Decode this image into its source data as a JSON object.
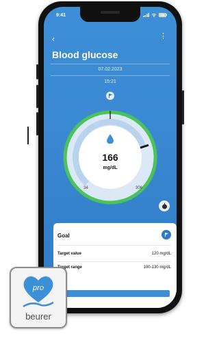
{
  "status_bar": {
    "time": "9:41"
  },
  "header": {
    "title": "Blood glucose"
  },
  "reading": {
    "date": "07.02.2023",
    "time": "15:21",
    "value": "166",
    "unit": "mg/dL",
    "scale_min": "34",
    "scale_max": "306"
  },
  "goal_card": {
    "title": "Goal",
    "rows": [
      {
        "label": "Target value",
        "value": "120 mg/dL"
      },
      {
        "label": "Target range",
        "value": "100-130 mg/dL"
      }
    ]
  },
  "logo": {
    "brand": "beurer",
    "badge": "pro"
  },
  "colors": {
    "accent": "#3d8fd6",
    "gauge_green": "#4cc35a",
    "drop": "#3d8fd6"
  },
  "icons": [
    "back-icon",
    "more-icon",
    "flag-icon",
    "drop-icon",
    "apple-icon",
    "goal-flag-icon",
    "signal-icon",
    "wifi-icon",
    "battery-icon"
  ]
}
